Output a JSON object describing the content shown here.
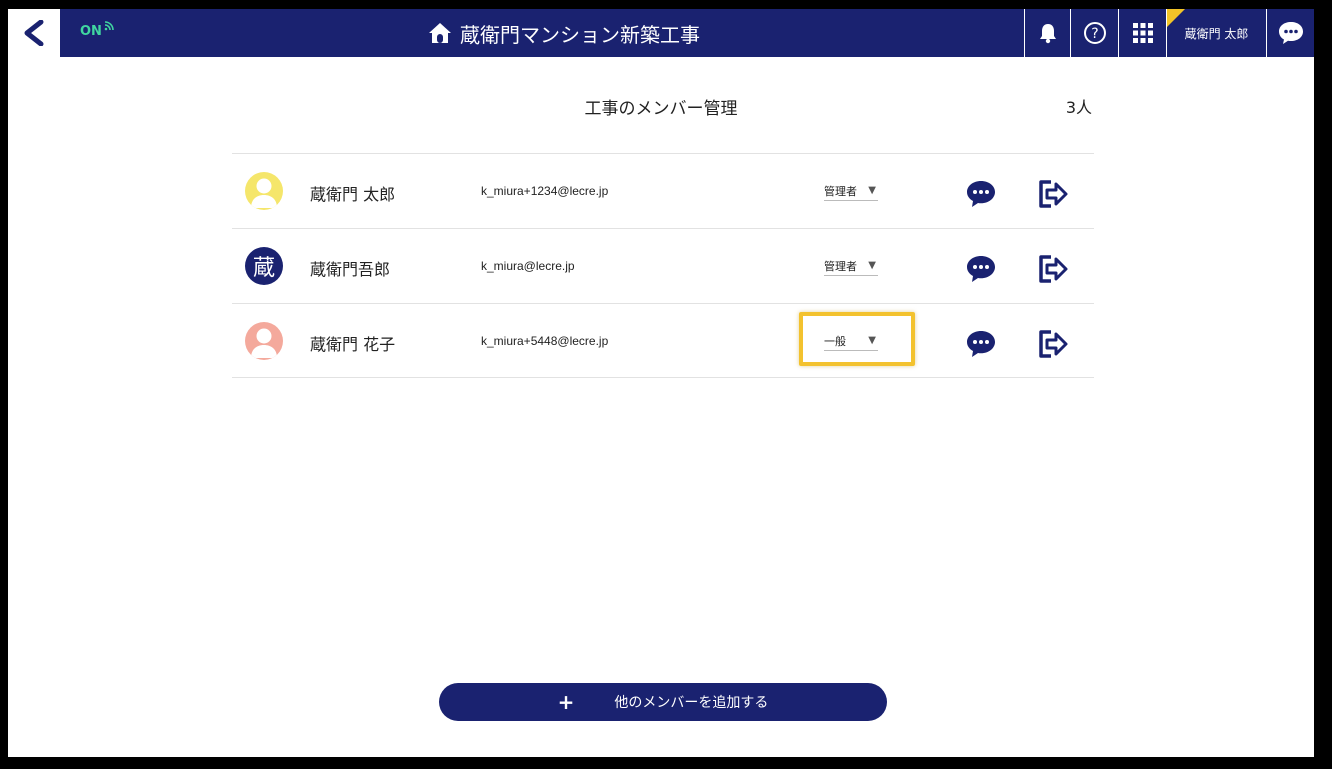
{
  "header": {
    "status": "ON",
    "title": "蔵衛門マンション新築工事",
    "user_name": "蔵衛門 太郎"
  },
  "page": {
    "title": "工事のメンバー管理",
    "member_count": "3人"
  },
  "members": [
    {
      "name": "蔵衛門 太郎",
      "email": "k_miura+1234@lecre.jp",
      "role": "管理者",
      "avatar": "person-icon",
      "avatar_color": "#f5e66b"
    },
    {
      "name": "蔵衛門吾郎",
      "email": "k_miura@lecre.jp",
      "role": "管理者",
      "avatar": "kura-logo",
      "avatar_text": "蔵",
      "avatar_color": "#1a2270"
    },
    {
      "name": "蔵衛門 花子",
      "email": "k_miura+5448@lecre.jp",
      "role": "一般",
      "avatar": "person-icon",
      "avatar_color": "#f4a99c",
      "highlighted": true
    }
  ],
  "actions": {
    "add_member_label": "他のメンバーを追加する",
    "add_icon": "+"
  },
  "colors": {
    "navy": "#1a2270",
    "online_green": "#40d6a0",
    "highlight": "#f3c22e"
  }
}
